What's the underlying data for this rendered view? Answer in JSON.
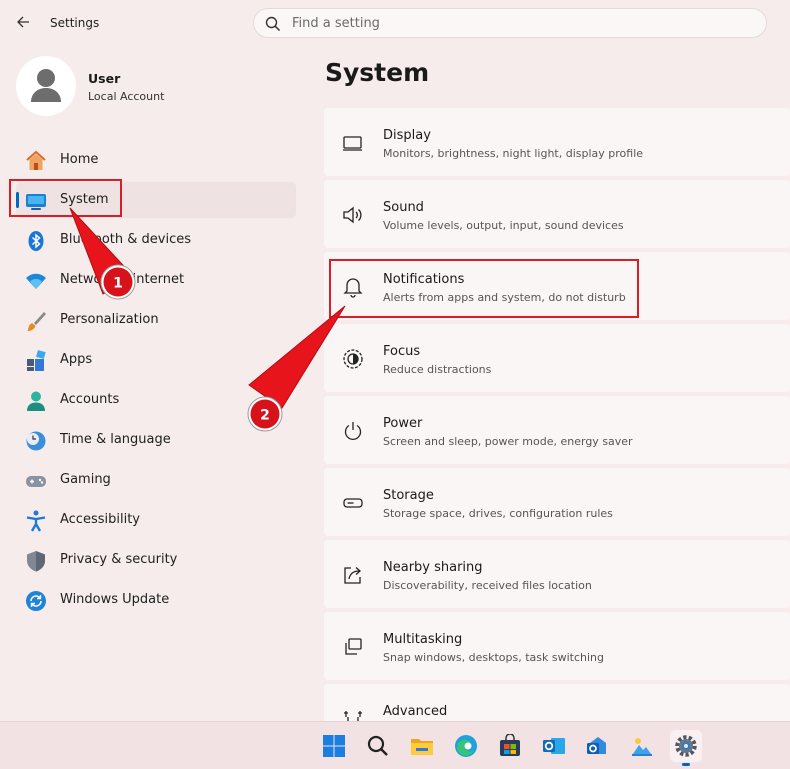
{
  "window": {
    "title": "Settings",
    "back_icon": "back-arrow-icon"
  },
  "search": {
    "placeholder": "Find a setting",
    "icon": "search-icon"
  },
  "profile": {
    "name": "User",
    "account_type": "Local Account"
  },
  "page": {
    "title": "System"
  },
  "sidebar": {
    "items": [
      {
        "label": "Home",
        "icon": "home-icon",
        "active": false
      },
      {
        "label": "System",
        "icon": "system-display-icon",
        "active": true
      },
      {
        "label": "Bluetooth & devices",
        "icon": "bluetooth-icon",
        "active": false
      },
      {
        "label": "Network & internet",
        "icon": "wifi-icon",
        "active": false
      },
      {
        "label": "Personalization",
        "icon": "brush-icon",
        "active": false
      },
      {
        "label": "Apps",
        "icon": "apps-icon",
        "active": false
      },
      {
        "label": "Accounts",
        "icon": "accounts-icon",
        "active": false
      },
      {
        "label": "Time & language",
        "icon": "clock-globe-icon",
        "active": false
      },
      {
        "label": "Gaming",
        "icon": "gamepad-icon",
        "active": false
      },
      {
        "label": "Accessibility",
        "icon": "accessibility-icon",
        "active": false
      },
      {
        "label": "Privacy & security",
        "icon": "shield-icon",
        "active": false
      },
      {
        "label": "Windows Update",
        "icon": "update-icon",
        "active": false
      }
    ]
  },
  "settings": [
    {
      "title": "Display",
      "subtitle": "Monitors, brightness, night light, display profile",
      "icon": "monitor-icon"
    },
    {
      "title": "Sound",
      "subtitle": "Volume levels, output, input, sound devices",
      "icon": "speaker-icon"
    },
    {
      "title": "Notifications",
      "subtitle": "Alerts from apps and system, do not disturb",
      "icon": "bell-icon"
    },
    {
      "title": "Focus",
      "subtitle": "Reduce distractions",
      "icon": "focus-icon"
    },
    {
      "title": "Power",
      "subtitle": "Screen and sleep, power mode, energy saver",
      "icon": "power-icon"
    },
    {
      "title": "Storage",
      "subtitle": "Storage space, drives, configuration rules",
      "icon": "storage-icon"
    },
    {
      "title": "Nearby sharing",
      "subtitle": "Discoverability, received files location",
      "icon": "share-icon"
    },
    {
      "title": "Multitasking",
      "subtitle": "Snap windows, desktops, task switching",
      "icon": "multitasking-icon"
    },
    {
      "title": "Advanced",
      "subtitle": "",
      "icon": "advanced-tools-icon"
    }
  ],
  "annotations": {
    "callouts": [
      {
        "number": "1"
      },
      {
        "number": "2"
      }
    ],
    "color": "#d81f26"
  },
  "taskbar": {
    "items": [
      {
        "name": "windows-start-icon"
      },
      {
        "name": "search-icon"
      },
      {
        "name": "file-explorer-icon"
      },
      {
        "name": "edge-icon"
      },
      {
        "name": "microsoft-store-icon"
      },
      {
        "name": "outlook-icon"
      },
      {
        "name": "new-outlook-icon"
      },
      {
        "name": "photos-icon"
      },
      {
        "name": "settings-gear-icon",
        "active": true
      }
    ]
  },
  "colors": {
    "accent": "#0067c0",
    "highlight": "#d81f26",
    "background": "#f6ecec"
  }
}
